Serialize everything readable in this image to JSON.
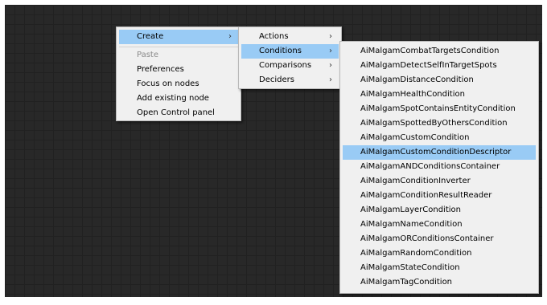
{
  "menu_main": {
    "items": [
      {
        "label": "Create",
        "arrow": "›"
      },
      {
        "label": "Paste"
      },
      {
        "label": "Preferences"
      },
      {
        "label": "Focus on nodes"
      },
      {
        "label": "Add existing node"
      },
      {
        "label": "Open Control panel"
      }
    ]
  },
  "menu_create": {
    "items": [
      {
        "label": "Actions",
        "arrow": "›"
      },
      {
        "label": "Conditions",
        "arrow": "›"
      },
      {
        "label": "Comparisons",
        "arrow": "›"
      },
      {
        "label": "Deciders",
        "arrow": "›"
      }
    ]
  },
  "menu_conditions": {
    "items": [
      "AiMalgamCombatTargetsCondition",
      "AiMalgamDetectSelfInTargetSpots",
      "AiMalgamDistanceCondition",
      "AiMalgamHealthCondition",
      "AiMalgamSpotContainsEntityCondition",
      "AiMalgamSpottedByOthersCondition",
      "AiMalgamCustomCondition",
      "AiMalgamCustomConditionDescriptor",
      "AiMalgamANDConditionsContainer",
      "AiMalgamConditionInverter",
      "AiMalgamConditionResultReader",
      "AiMalgamLayerCondition",
      "AiMalgamNameCondition",
      "AiMalgamORConditionsContainer",
      "AiMalgamRandomCondition",
      "AiMalgamStateCondition",
      "AiMalgamTagCondition"
    ]
  }
}
